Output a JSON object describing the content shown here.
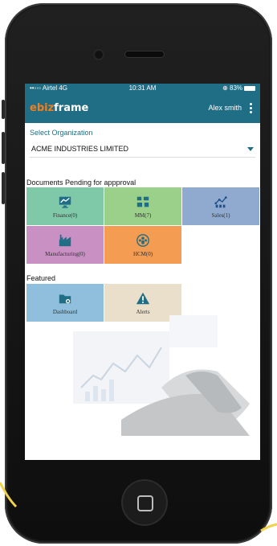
{
  "colors": {
    "primary": "#1f6e86",
    "accent": "#f07e1f",
    "finance": "#7fc9a8",
    "mm": "#9ad08a",
    "sales": "#8fa9cf",
    "manufacturing": "#c990c4",
    "hcm": "#f39c52",
    "dashboard": "#8fbfdc",
    "alerts": "#eadfcb"
  },
  "status": {
    "carrier": "••◦◦◦ Airtel  4G",
    "time": "10:31 AM",
    "battery": "⊕ 83%"
  },
  "app": {
    "logo_prefix": "ebiz",
    "logo_suffix": "frame",
    "user": "Alex smith"
  },
  "org": {
    "label": "Select Organization",
    "value": "ACME INDUSTRIES LIMITED"
  },
  "pending": {
    "title": "Documents Pending for appproval",
    "tiles": [
      {
        "label": "Finance(0)",
        "icon": "monitor-chart-icon"
      },
      {
        "label": "MM(7)",
        "icon": "inventory-icon"
      },
      {
        "label": "Sales(1)",
        "icon": "sales-graph-icon"
      },
      {
        "label": "Manufacturing(0)",
        "icon": "factory-icon"
      },
      {
        "label": "HCM(0)",
        "icon": "people-icon"
      }
    ]
  },
  "featured": {
    "title": "Featured",
    "tiles": [
      {
        "label": "Dashboard",
        "icon": "folder-icon"
      },
      {
        "label": "Alerts",
        "icon": "alert-triangle-icon"
      }
    ]
  }
}
